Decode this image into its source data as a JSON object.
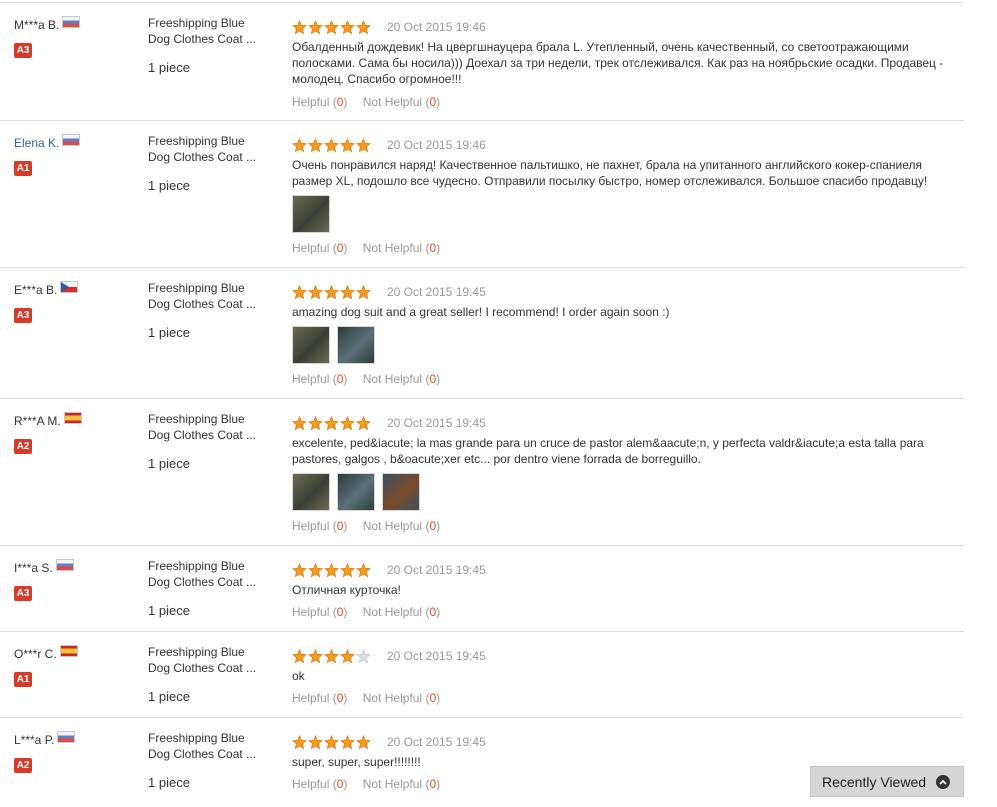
{
  "helpful_label": "Helpful",
  "not_helpful_label": "Not Helpful",
  "colors": {
    "star": "#f39a1f",
    "badge": "#d83a2a",
    "count": "#e64b1e",
    "link": "#336699"
  },
  "recently_viewed": {
    "label": "Recently Viewed",
    "icon": "chevron-up-icon"
  },
  "reviews": [
    {
      "user": "M***a B.",
      "country": "ru",
      "level": "A3",
      "product": [
        "Freeshipping Blue",
        "Dog Clothes Coat ..."
      ],
      "quantity": "1 piece",
      "stars": 5,
      "date": "20 Oct 2015 19:46",
      "text": "Обалденный дождевик! На цвергшнауцера брала L. Утепленный, очень качественный, со светоотражающими полосками. Сама бы носила))) Доехал за три недели, трек отслеживался. Как раз на ноябрьские осадки. Продавец - молодец. Спасибо огромное!!!",
      "photos": [],
      "helpful": "0",
      "not_helpful": "0"
    },
    {
      "user": "Elena K.",
      "country": "ru",
      "level": "A1",
      "product": [
        "Freeshipping Blue",
        "Dog Clothes Coat ..."
      ],
      "quantity": "1 piece",
      "stars": 5,
      "date": "20 Oct 2015 19:46",
      "text": "Очень понравился наряд! Качественное пальтишко, не пахнет, брала на упитанного английского кокер-спаниеля размер XL, подошло все чудесно. Отправили посылку быстро, номер отслеживался. Большое спасибо продавцу!",
      "photos": [
        "photo-1"
      ],
      "helpful": "0",
      "not_helpful": "0"
    },
    {
      "user": "E***a B.",
      "country": "cz",
      "level": "A3",
      "product": [
        "Freeshipping Blue",
        "Dog Clothes Coat ..."
      ],
      "quantity": "1 piece",
      "stars": 5,
      "date": "20 Oct 2015 19:45",
      "text": "amazing dog suit and a great seller! I recommend! I order again soon :)",
      "photos": [
        "photo-1",
        "photo-2"
      ],
      "helpful": "0",
      "not_helpful": "0"
    },
    {
      "user": "R***A M.",
      "country": "es",
      "level": "A2",
      "product": [
        "Freeshipping Blue",
        "Dog Clothes Coat ..."
      ],
      "quantity": "1 piece",
      "stars": 5,
      "date": "20 Oct 2015 19:45",
      "text": "excelente, ped&iacute; la mas grande para un cruce de pastor alem&aacute;n, y perfecta valdr&iacute;a esta talla para pastores, galgos , b&oacute;xer etc... por dentro viene forrada de borreguillo.",
      "photos": [
        "photo-1",
        "photo-2",
        "photo-3"
      ],
      "helpful": "0",
      "not_helpful": "0"
    },
    {
      "user": "I***a S.",
      "country": "ru",
      "level": "A3",
      "product": [
        "Freeshipping Blue",
        "Dog Clothes Coat ..."
      ],
      "quantity": "1 piece",
      "stars": 5,
      "date": "20 Oct 2015 19:45",
      "text": "Отличная курточка!",
      "photos": [],
      "helpful": "0",
      "not_helpful": "0"
    },
    {
      "user": "O***r C.",
      "country": "es",
      "level": "A1",
      "product": [
        "Freeshipping Blue",
        "Dog Clothes Coat ..."
      ],
      "quantity": "1 piece",
      "stars": 4,
      "date": "20 Oct 2015 19:45",
      "text": "ok",
      "photos": [],
      "helpful": "0",
      "not_helpful": "0"
    },
    {
      "user": "L***a P.",
      "country": "ru",
      "level": "A2",
      "product": [
        "Freeshipping Blue",
        "Dog Clothes Coat ..."
      ],
      "quantity": "1 piece",
      "stars": 5,
      "date": "20 Oct 2015 19:45",
      "text": "super, super, super!!!!!!!!",
      "photos": [],
      "helpful": "0",
      "not_helpful": "0"
    }
  ]
}
